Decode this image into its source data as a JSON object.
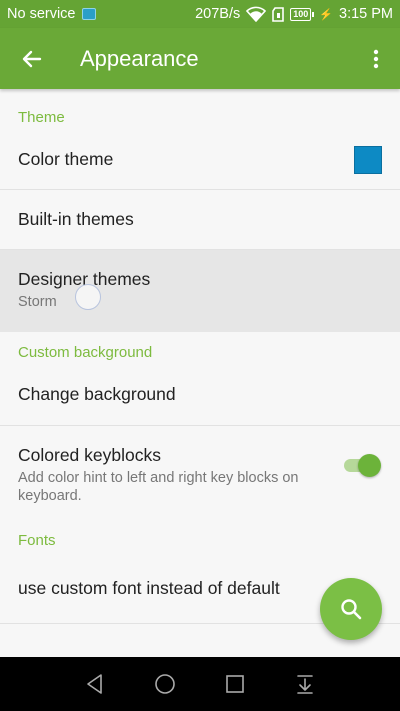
{
  "status_bar": {
    "carrier": "No service",
    "net_speed": "207B/s",
    "battery": "100",
    "time": "3:15 PM"
  },
  "app_bar": {
    "title": "Appearance"
  },
  "sections": {
    "theme": {
      "header": "Theme",
      "color_theme": {
        "title": "Color theme",
        "swatch_color": "#0d8ac4"
      },
      "builtin": {
        "title": "Built-in themes"
      },
      "designer": {
        "title": "Designer themes",
        "summary": "Storm"
      }
    },
    "custom_background": {
      "header": "Custom background",
      "change_background": {
        "title": "Change background"
      },
      "colored_keyblocks": {
        "title": "Colored keyblocks",
        "summary": "Add color hint to left and right key blocks on keyboard.",
        "enabled": true
      }
    },
    "fonts": {
      "header": "Fonts",
      "custom_font": {
        "title": "use custom font instead of default"
      }
    }
  },
  "colors": {
    "primary": "#6aa937",
    "accent": "#7dbb3f",
    "status_bar": "#65a434"
  },
  "icons": {
    "back": "arrow-back-icon",
    "more": "more-vert-icon",
    "fab": "search-icon"
  }
}
